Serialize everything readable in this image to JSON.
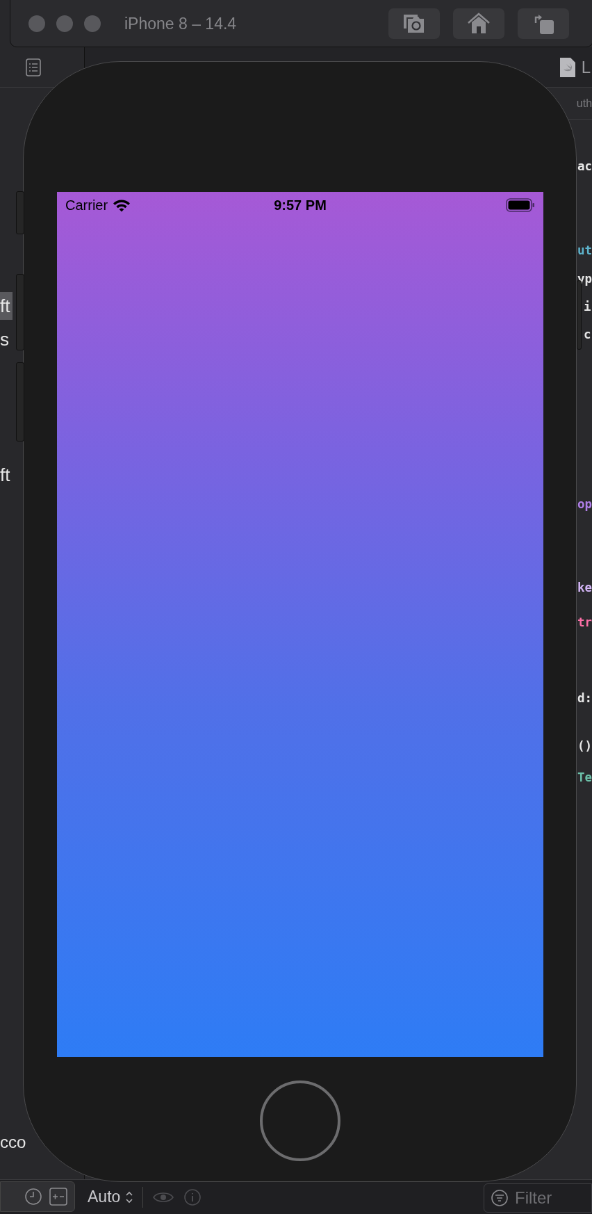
{
  "xcode": {
    "navigator": {
      "items": [
        {
          "label": "ft",
          "selected": true
        },
        {
          "label": "s",
          "selected": false
        },
        {
          "label": "ft",
          "selected": false
        },
        {
          "label": "cco",
          "selected": false
        }
      ]
    },
    "editor": {
      "tab": "L",
      "breadcrumb": "uth",
      "code_lines": [
        {
          "text": "ac",
          "color": "#e6e6e6"
        },
        {
          "text": "ut",
          "color": "#5db3cc"
        },
        {
          "text": "yp",
          "color": "#e6e6e6"
        },
        {
          "text": "i",
          "color": "#e6e6e6"
        },
        {
          "text": "c",
          "color": "#e6e6e6"
        },
        {
          "text": "op",
          "color": "#b07ee8"
        },
        {
          "text": "ke",
          "color": "#d2b4f5"
        },
        {
          "text": "tr",
          "color": "#fc6fa7"
        },
        {
          "text": "d:",
          "color": "#e6e6e6"
        },
        {
          "text": "()",
          "color": "#e6e6e6"
        },
        {
          "text": "Te",
          "color": "#6cbfa8"
        }
      ]
    },
    "debug_bar": {
      "scheme": "Auto",
      "filter": {
        "placeholder": "Filter"
      }
    }
  },
  "simulator": {
    "title": "iPhone 8 – 14.4",
    "status_bar": {
      "carrier": "Carrier",
      "time": "9:57 PM"
    }
  }
}
